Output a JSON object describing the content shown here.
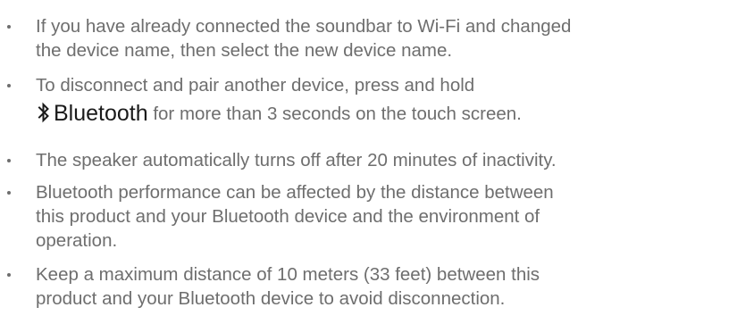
{
  "notes": [
    {
      "lines": [
        "If you have already connected the soundbar to Wi-Fi and changed",
        "the device name, then select the new device name."
      ]
    },
    {
      "lines": [
        "To disconnect and pair another device, press and hold"
      ],
      "icon": "bluetooth-icon",
      "button_label": "Bluetooth",
      "after_button": " for more than 3 seconds on the touch screen."
    },
    {
      "lines": [
        "The speaker automatically turns off after 20 minutes of inactivity."
      ]
    },
    {
      "lines": [
        "Bluetooth performance can be affected by the distance between",
        "this product and your Bluetooth device and the environment of",
        "operation."
      ]
    },
    {
      "lines": [
        "Keep a maximum distance of 10 meters (33 feet) between this",
        "product and your Bluetooth device to avoid disconnection."
      ]
    }
  ],
  "colors": {
    "body_text": "#6e6e6e",
    "emphasis_text": "#1a1a1a",
    "background": "#ffffff"
  }
}
